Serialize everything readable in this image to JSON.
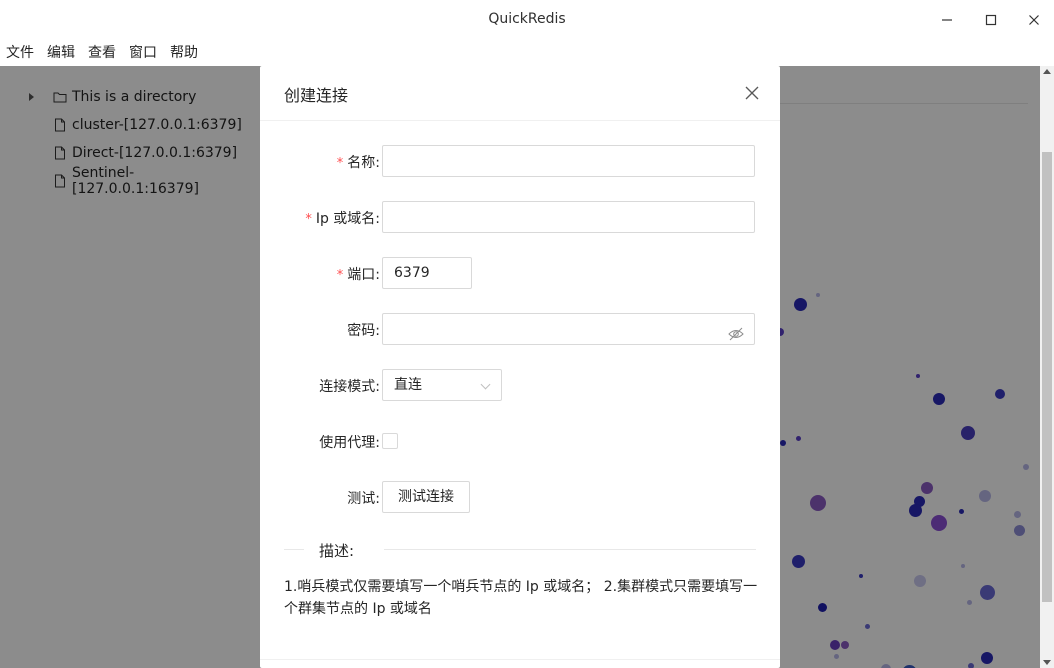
{
  "window": {
    "title": "QuickRedis"
  },
  "menu": [
    "文件",
    "编辑",
    "查看",
    "窗口",
    "帮助"
  ],
  "tree": {
    "items": [
      {
        "label": "This is a directory",
        "icon": "folder-icon"
      },
      {
        "label": "cluster-[127.0.0.1:6379]",
        "icon": "file-icon"
      },
      {
        "label": "Direct-[127.0.0.1:6379]",
        "icon": "file-icon"
      },
      {
        "label": "Sentinel-[127.0.0.1:16379]",
        "icon": "file-icon"
      }
    ]
  },
  "modal": {
    "title": "创建连接",
    "fields": {
      "name": {
        "label": "名称",
        "required": "*",
        "value": ""
      },
      "host": {
        "label": "Ip 或域名",
        "required": "*",
        "value": ""
      },
      "port": {
        "label": "端口",
        "required": "*",
        "value": "6379"
      },
      "password": {
        "label": "密码",
        "value": ""
      },
      "mode": {
        "label": "连接模式",
        "value": "直连"
      },
      "proxy": {
        "label": "使用代理",
        "checked": false
      },
      "test": {
        "label": "测试",
        "button": "测试连接"
      }
    },
    "colon": ":",
    "divider": "描述:",
    "description": "1.哨兵模式仅需要填写一个哨兵节点的 Ip 或域名； 2.集群模式只需要填写一个群集节点的 Ip 或域名"
  },
  "colors": {
    "required": "#ff4d4f",
    "bubble_dark": "#1f1fb0",
    "bubble_purple": "#8a4fd6",
    "bubble_light": "#b9b9ea"
  }
}
